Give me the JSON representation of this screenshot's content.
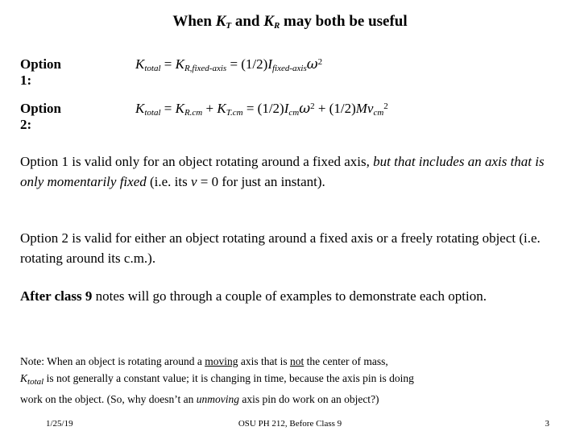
{
  "slide": {
    "title_parts": {
      "a": "When ",
      "k1": "K",
      "k1sub": "T",
      "b": " and ",
      "k2": "K",
      "k2sub": "R",
      "c": " may both be useful"
    },
    "equations": [
      {
        "label": "Option 1:",
        "parts": {
          "k": "K",
          "ksub": "total",
          "eq1": " =  ",
          "k2": "K",
          "k2sub": "R,fixed-axis",
          "eq2": "  =  (1/2)",
          "i": "I",
          "isub": "fixed-axis",
          "omega": "ω",
          "omegasup": "2"
        }
      },
      {
        "label": "Option 2:",
        "parts": {
          "k": "K",
          "ksub": "total",
          "eq1": " =  ",
          "k2": "K",
          "k2sub": "R.cm",
          "plus1": " + ",
          "k3": "K",
          "k3sub": "T.cm",
          "eq2": "  =  (1/2)",
          "i": "I",
          "isub": "cm",
          "omega": "ω",
          "omegasup": "2",
          "plus2": " + (1/2)",
          "m": "M",
          "v": "v",
          "vsub": "cm",
          "vsup": "2"
        }
      }
    ],
    "paragraph1": {
      "t1": "Option 1 is valid only for an object rotating around a fixed axis, ",
      "t2_italic": "but that includes an axis that is only momentarily fixed",
      "t3": " (i.e. its ",
      "v_italic": "v",
      "t4": " = 0 for just an instant)."
    },
    "paragraph2": "Option 2 is valid for either an object rotating around a fixed axis or a freely rotating object (i.e. rotating around its c.m.).",
    "paragraph3": {
      "bold": "After class 9",
      "rest": " notes will go through a couple of examples to demonstrate each option."
    },
    "note": {
      "n1": "Note:  When an object is rotating around a ",
      "n2_underline": "moving",
      "n3": " axis that is ",
      "n4_underline": "not",
      "n5": " the center of mass,",
      "n6_italic": "K",
      "n6_sub": "total",
      "n7": " is not generally a constant value; it is changing in time, because the axis pin is doing",
      "n8": "work on the object. (So, why doesn’t an ",
      "n9_italic": "unmoving",
      "n10": " axis pin do work on an object?)"
    },
    "footer": {
      "date": "1/25/19",
      "center": "OSU PH 212, Before Class 9",
      "page": "3"
    }
  }
}
